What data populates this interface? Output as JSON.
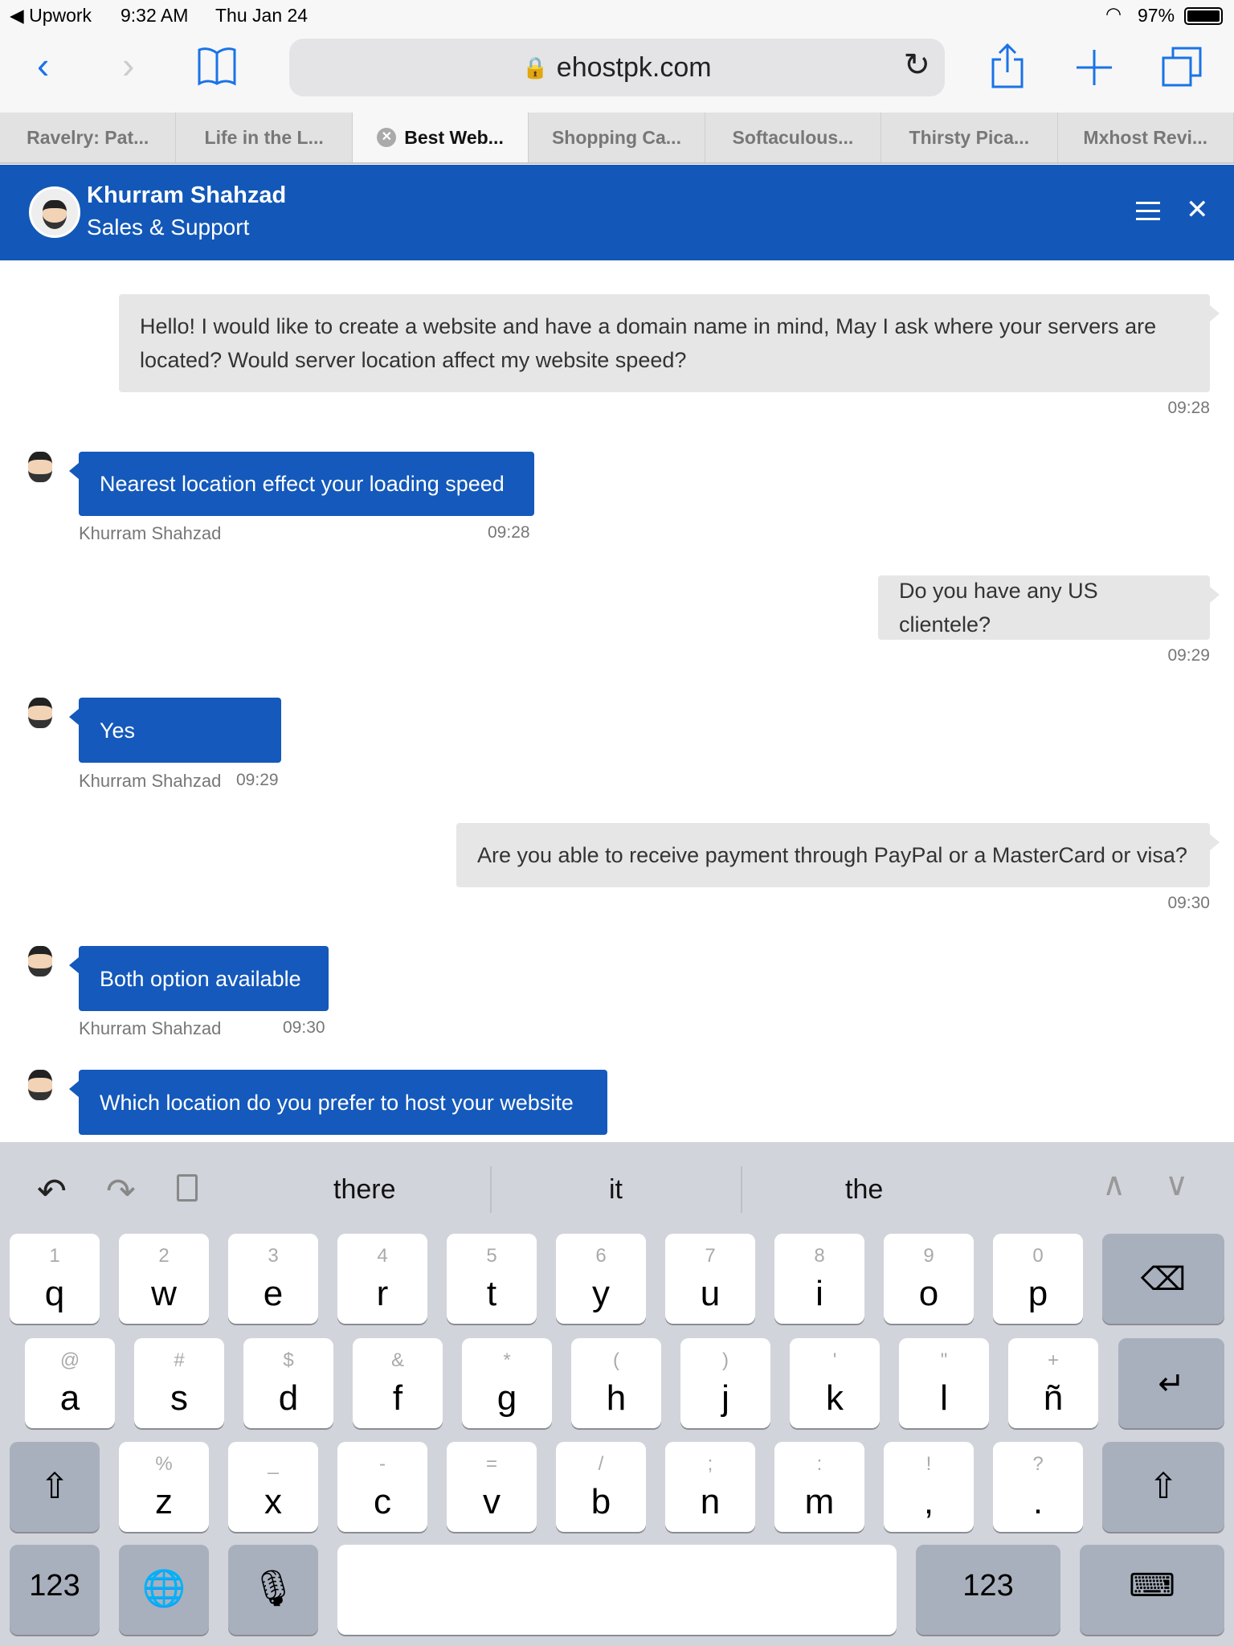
{
  "status": {
    "back_app": "Upwork",
    "time": "9:32 AM",
    "date": "Thu Jan 24",
    "battery": "97%"
  },
  "browser": {
    "url": "ehostpk.com",
    "tabs": [
      {
        "label": "Ravelry: Pat..."
      },
      {
        "label": "Life in the L..."
      },
      {
        "label": "Best Web...",
        "active": true
      },
      {
        "label": "Shopping Ca..."
      },
      {
        "label": "Softaculous..."
      },
      {
        "label": "Thirsty Pica..."
      },
      {
        "label": "Mxhost Revi..."
      }
    ]
  },
  "chat": {
    "agent_name": "Khurram Shahzad",
    "agent_role": "Sales & Support",
    "accent": "#1459bb",
    "messages": [
      {
        "from": "me",
        "text": "Hello! I would like to create a website and have a domain name in mind,  May I ask where your servers are located? Would server location affect my website speed?",
        "time": "09:28"
      },
      {
        "from": "agent",
        "text": "Nearest location effect your loading speed",
        "name": "Khurram Shahzad",
        "time": "09:28"
      },
      {
        "from": "me",
        "text": "Do you have any US clientele?",
        "time": "09:29"
      },
      {
        "from": "agent",
        "text": "Yes",
        "name": "Khurram Shahzad",
        "time": "09:29"
      },
      {
        "from": "me",
        "text": "Are you able to receive payment through PayPal or a MasterCard or visa?",
        "time": "09:30"
      },
      {
        "from": "agent",
        "text": "Both option available",
        "name": "Khurram Shahzad",
        "time": "09:30"
      },
      {
        "from": "agent",
        "text": "Which location do you prefer to host your website"
      }
    ]
  },
  "keyboard": {
    "suggestions": [
      "there",
      "it",
      "the"
    ],
    "rows": [
      [
        [
          "1",
          "q"
        ],
        [
          "2",
          "w"
        ],
        [
          "3",
          "e"
        ],
        [
          "4",
          "r"
        ],
        [
          "5",
          "t"
        ],
        [
          "6",
          "y"
        ],
        [
          "7",
          "u"
        ],
        [
          "8",
          "i"
        ],
        [
          "9",
          "o"
        ],
        [
          "0",
          "p"
        ]
      ],
      [
        [
          "@",
          "a"
        ],
        [
          "#",
          "s"
        ],
        [
          "$",
          "d"
        ],
        [
          "&",
          "f"
        ],
        [
          "*",
          "g"
        ],
        [
          "(",
          "h"
        ],
        [
          ")",
          "j"
        ],
        [
          "'",
          "k"
        ],
        [
          "\"",
          "l"
        ],
        [
          "+",
          "ñ"
        ]
      ],
      [
        [
          "%",
          "z"
        ],
        [
          "_",
          "x"
        ],
        [
          "-",
          "c"
        ],
        [
          "=",
          "v"
        ],
        [
          "/",
          "b"
        ],
        [
          ";",
          "n"
        ],
        [
          ":",
          "m"
        ],
        [
          "!",
          ","
        ],
        [
          "?",
          "."
        ]
      ]
    ],
    "numbers_label": "123"
  }
}
